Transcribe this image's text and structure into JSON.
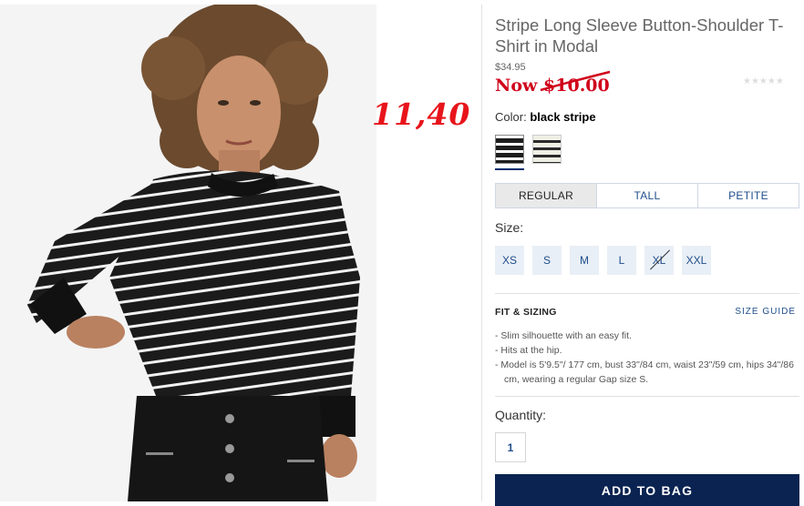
{
  "annotation": {
    "handwritten_price": "11,40"
  },
  "product": {
    "title": "Stripe Long Sleeve Button-Shoulder T-Shirt in Modal",
    "original_price": "$34.95",
    "sale_prefix": "Now",
    "sale_price": "$10.00",
    "rating_stars": "★★★★★",
    "color_label": "Color:",
    "color_value": "black stripe",
    "swatches": [
      "black stripe",
      "cream stripe"
    ]
  },
  "fit_tabs": [
    "REGULAR",
    "TALL",
    "PETITE"
  ],
  "size": {
    "label": "Size:",
    "options": [
      "XS",
      "S",
      "M",
      "L",
      "XL",
      "XXL"
    ],
    "unavailable": [
      "XL"
    ]
  },
  "fit_sizing": {
    "heading": "FIT & SIZING",
    "guide_link": "SIZE GUIDE",
    "bullets": [
      "- Slim silhouette with an easy fit.",
      "- Hits at the hip.",
      "- Model is 5'9.5\"/ 177 cm, bust 33\"/84 cm, waist 23\"/59 cm, hips 34\"/86 cm, wearing a regular Gap size S."
    ]
  },
  "quantity": {
    "label": "Quantity:",
    "value": "1"
  },
  "cta": {
    "add_to_bag": "ADD TO BAG"
  },
  "colors": {
    "sale_red": "#d0021b",
    "link_blue": "#1f4e8c",
    "button_navy": "#0a2350"
  }
}
